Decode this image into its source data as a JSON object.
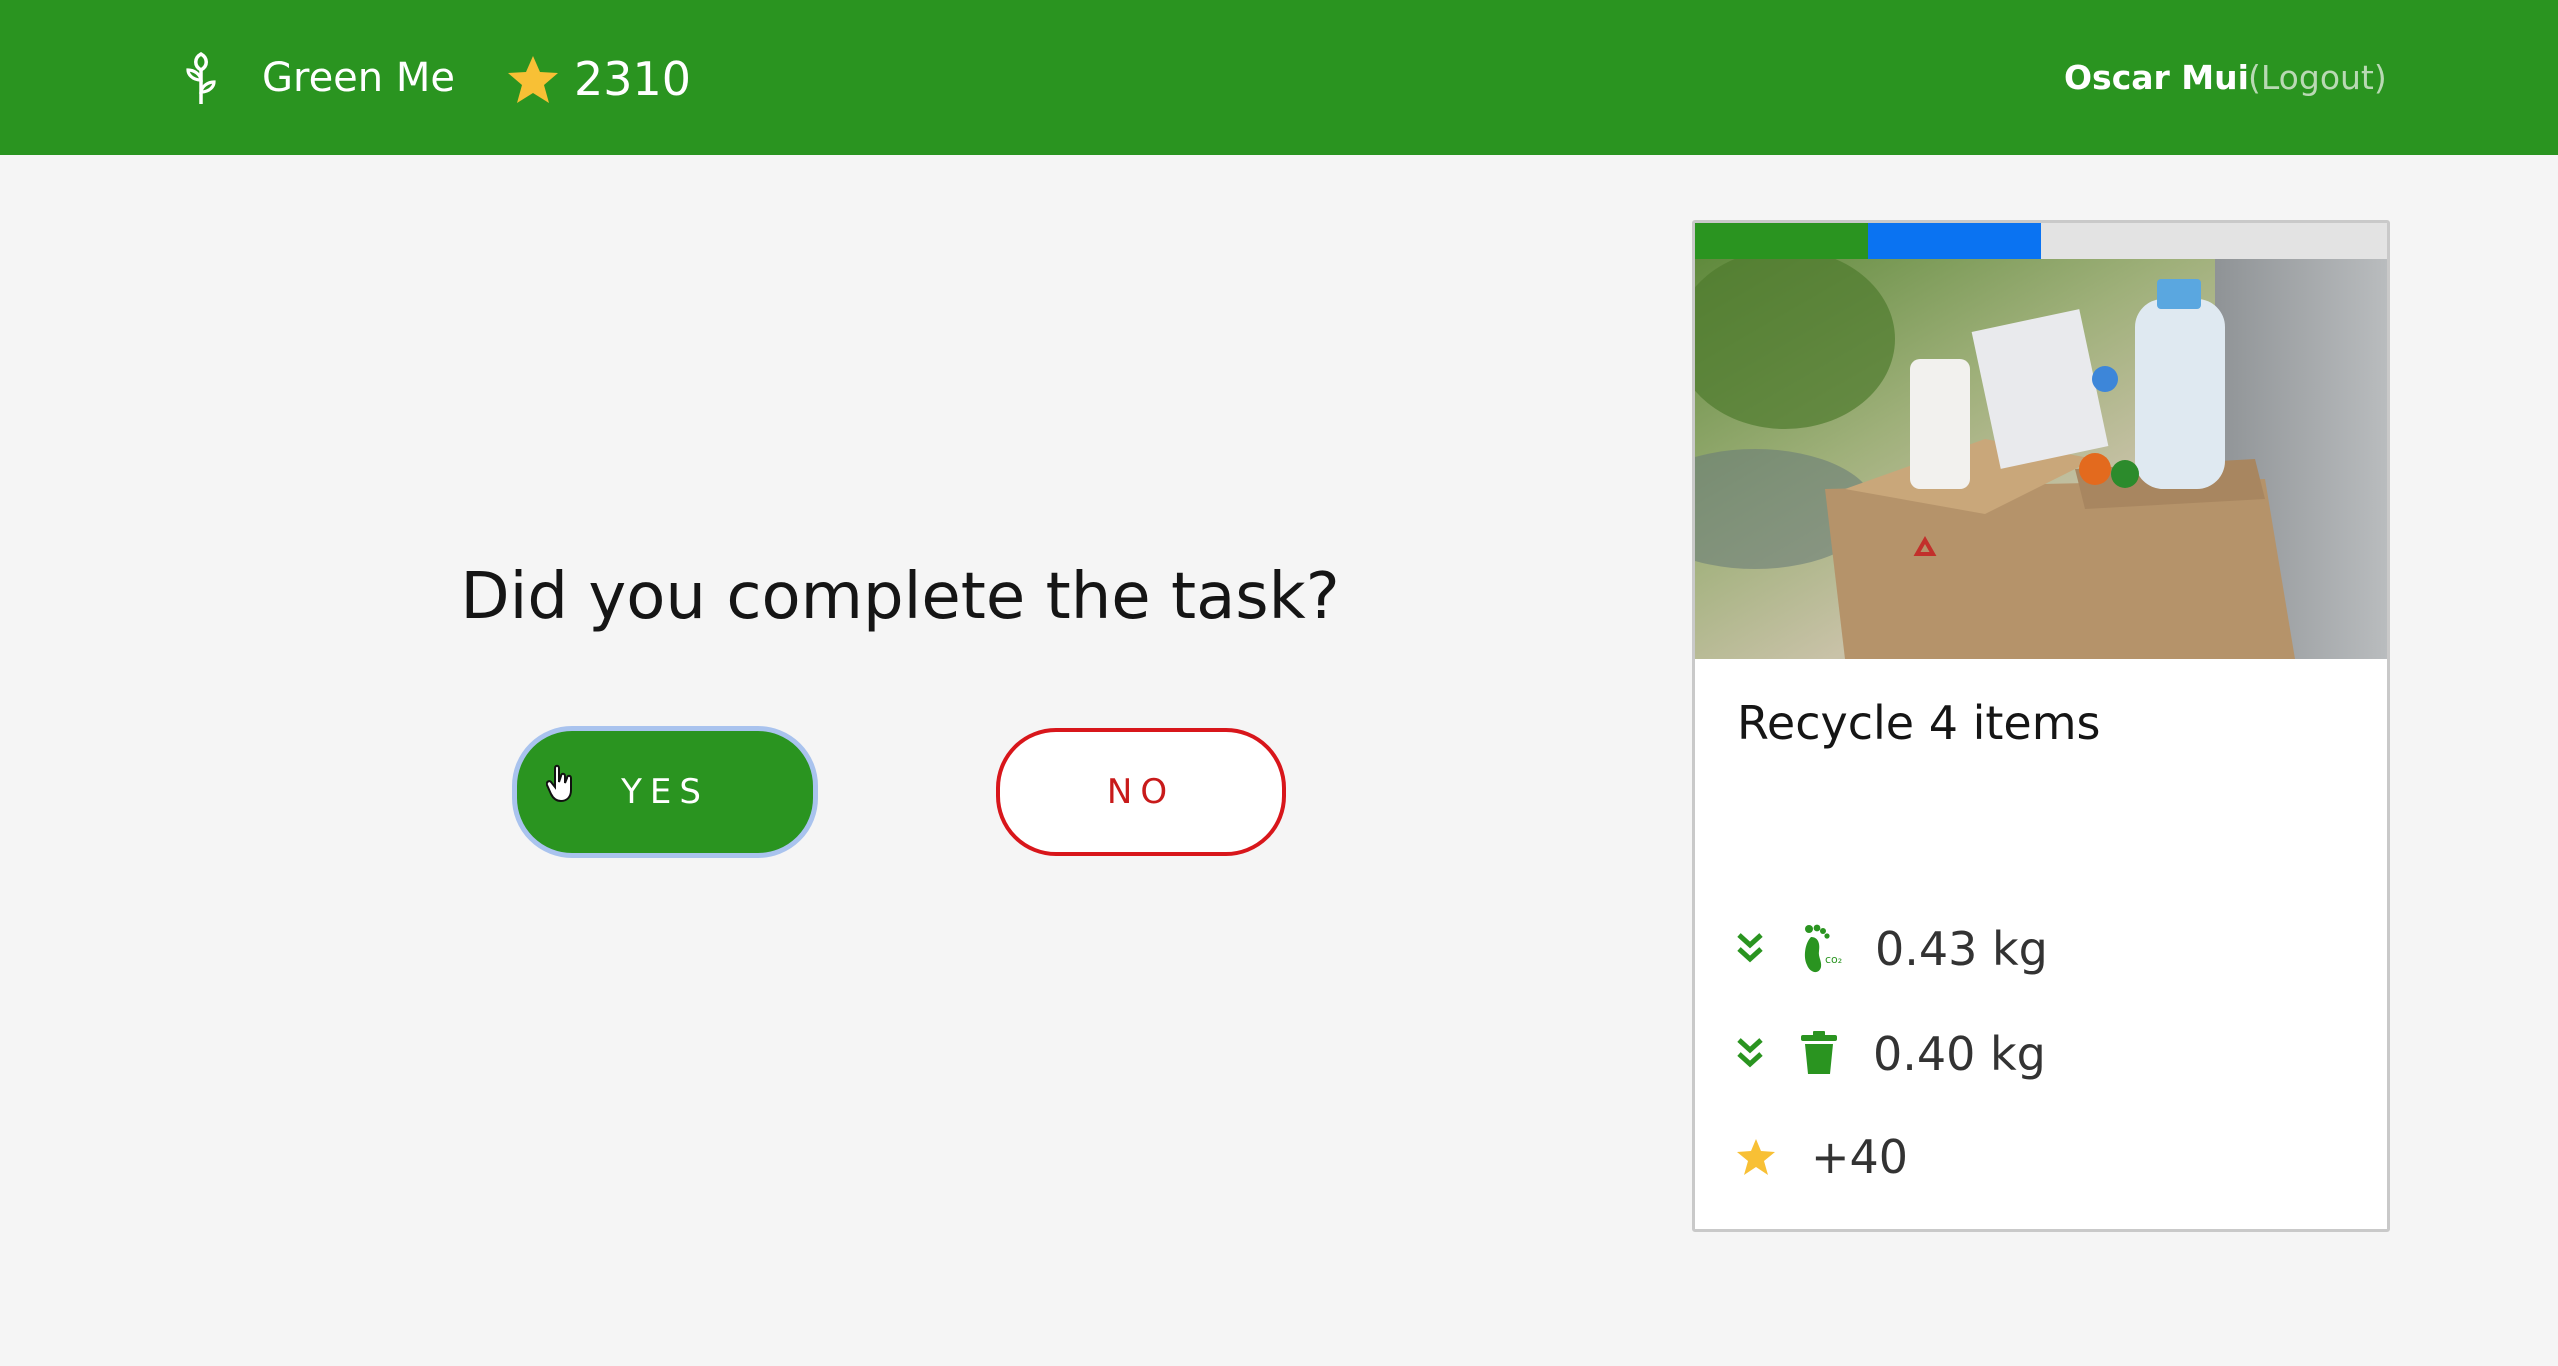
{
  "header": {
    "brand": "Green Me",
    "points": "2310",
    "user_name": "Oscar Mui",
    "logout_label": "(Logout)"
  },
  "main": {
    "question": "Did you complete the task?",
    "yes_label": "YES",
    "no_label": "NO"
  },
  "task_card": {
    "progress": [
      {
        "fraction": 0.25,
        "color": "#2a9420"
      },
      {
        "fraction": 0.25,
        "color": "#0a73f2"
      },
      {
        "fraction": 0.5,
        "color": "#e3e3e3"
      }
    ],
    "image_subject": "cardboard-box-of-recyclables-photo",
    "title": "Recycle 4 items",
    "stats": [
      {
        "trend_icon": "double-chevron-down-icon",
        "icon": "footprint-co2-icon",
        "value": "0.43 kg"
      },
      {
        "trend_icon": "double-chevron-down-icon",
        "icon": "trash-bin-icon",
        "value": "0.40 kg"
      },
      {
        "icon": "star-icon",
        "value": "+40"
      }
    ]
  },
  "colors": {
    "brand_green": "#2a9420",
    "accent_blue": "#0a73f2",
    "no_red": "#d8161b",
    "star_yellow": "#f8c035"
  }
}
